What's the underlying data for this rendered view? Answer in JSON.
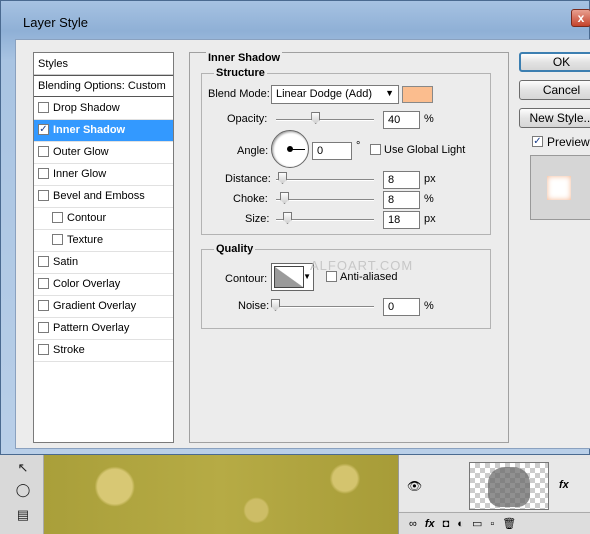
{
  "dialog": {
    "title": "Layer Style",
    "close_label": "x"
  },
  "styles_list": {
    "header": "Styles",
    "blending_options": "Blending Options: Custom",
    "items": [
      {
        "label": "Drop Shadow",
        "checked": false,
        "indent": false
      },
      {
        "label": "Inner Shadow",
        "checked": true,
        "indent": false,
        "selected": true
      },
      {
        "label": "Outer Glow",
        "checked": false,
        "indent": false
      },
      {
        "label": "Inner Glow",
        "checked": false,
        "indent": false
      },
      {
        "label": "Bevel and Emboss",
        "checked": false,
        "indent": false
      },
      {
        "label": "Contour",
        "checked": false,
        "indent": true
      },
      {
        "label": "Texture",
        "checked": false,
        "indent": true
      },
      {
        "label": "Satin",
        "checked": false,
        "indent": false
      },
      {
        "label": "Color Overlay",
        "checked": false,
        "indent": false
      },
      {
        "label": "Gradient Overlay",
        "checked": false,
        "indent": false
      },
      {
        "label": "Pattern Overlay",
        "checked": false,
        "indent": false
      },
      {
        "label": "Stroke",
        "checked": false,
        "indent": false
      }
    ]
  },
  "inner_shadow": {
    "section_title": "Inner Shadow",
    "structure": {
      "title": "Structure",
      "blend_mode_label": "Blend Mode:",
      "blend_mode_value": "Linear Dodge (Add)",
      "color": "#fbbd8e",
      "opacity_label": "Opacity:",
      "opacity_value": "40",
      "opacity_unit": "%",
      "opacity_fraction": 0.4,
      "angle_label": "Angle:",
      "angle_value": "0",
      "angle_unit": "°",
      "use_global_light_label": "Use Global Light",
      "use_global_light_checked": false,
      "distance_label": "Distance:",
      "distance_value": "8",
      "distance_unit": "px",
      "choke_label": "Choke:",
      "choke_value": "8",
      "choke_unit": "%",
      "size_label": "Size:",
      "size_value": "18",
      "size_unit": "px"
    },
    "quality": {
      "title": "Quality",
      "contour_label": "Contour:",
      "anti_aliased_label": "Anti-aliased",
      "anti_aliased_checked": false,
      "noise_label": "Noise:",
      "noise_value": "0",
      "noise_unit": "%"
    }
  },
  "buttons": {
    "ok": "OK",
    "cancel": "Cancel",
    "new_style": "New Style...",
    "preview_label": "Preview",
    "preview_checked": true
  },
  "watermark": "ALFOART.COM",
  "layers_panel": {
    "fx_label": "fx"
  }
}
